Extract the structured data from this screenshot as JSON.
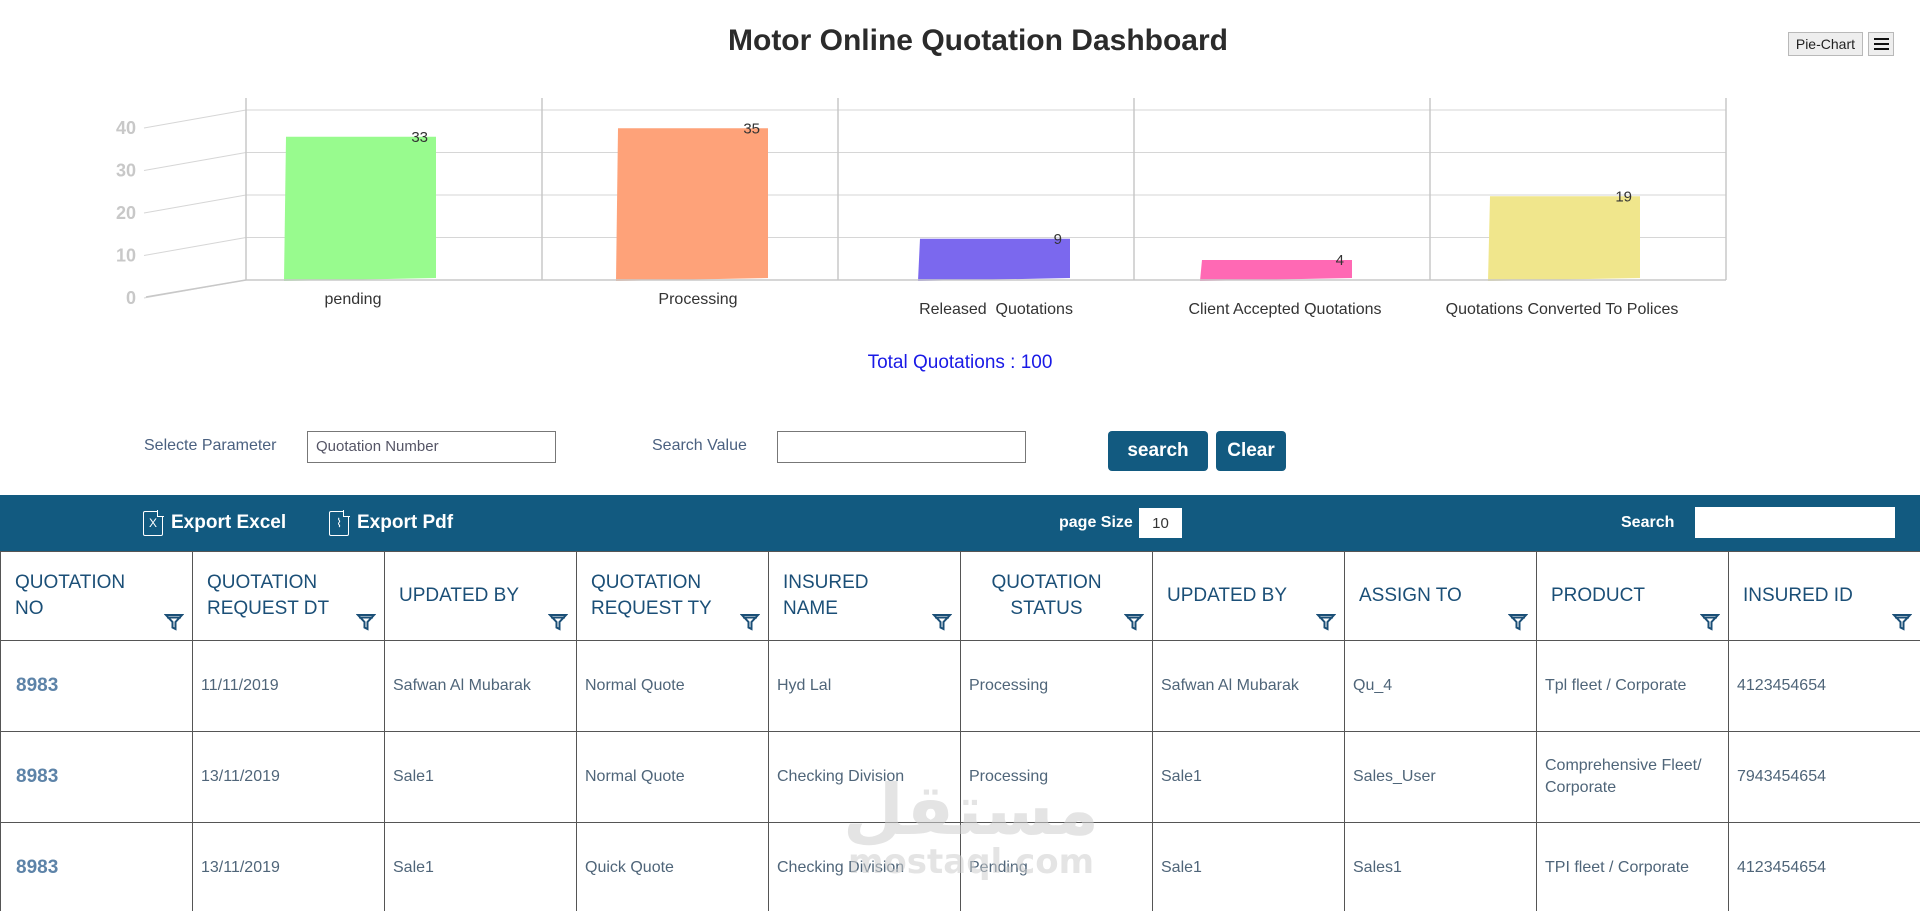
{
  "page_title": "Motor Online Quotation Dashboard",
  "chart_controls": {
    "pie_chart_label": "Pie-Chart",
    "menu_icon": "hamburger-menu-icon"
  },
  "chart_data": {
    "type": "bar",
    "style": "3d",
    "categories": [
      "pending",
      "Processing",
      "Released  Quotations",
      "Client Accepted Quotations",
      "Quotations Converted To Polices"
    ],
    "values": [
      33,
      35,
      9,
      4,
      19
    ],
    "colors": [
      "#98fb8e",
      "#fea279",
      "#7b68ee",
      "#ff69b4",
      "#f0e68c"
    ],
    "ylim": [
      0,
      40
    ],
    "yticks": [
      0,
      10,
      20,
      30,
      40
    ],
    "grid": true,
    "title": "",
    "xlabel": "",
    "ylabel": ""
  },
  "total_label": "Total Quotations : 100",
  "search_form": {
    "parameter_label": "Selecte Parameter",
    "parameter_value": "Quotation Number",
    "search_value_label": "Search Value",
    "search_value": "",
    "search_button": "search",
    "clear_button": "Clear"
  },
  "toolbar": {
    "export_excel": "Export Excel",
    "excel_icon_glyph": "X",
    "export_pdf": "Export Pdf",
    "pdf_icon_glyph": "⌇",
    "page_size_label": "page Size",
    "page_size_value": "10",
    "search_label": "Search",
    "background_color": "#125a80"
  },
  "table": {
    "headers": [
      "QUOTATION NO",
      "QUOTATION REQUEST DT",
      "UPDATED BY",
      "QUOTATION REQUEST TY",
      "INSURED NAME",
      "QUOTATION STATUS",
      "UPDATED BY",
      "ASSIGN TO",
      "PRODUCT",
      "INSURED ID"
    ],
    "rows": [
      [
        "8983",
        "11/11/2019",
        "Safwan Al Mubarak",
        "Normal Quote",
        "Hyd Lal",
        "Processing",
        "Safwan Al Mubarak",
        "Qu_4",
        "Tpl fleet / Corporate",
        "4123454654"
      ],
      [
        "8983",
        "13/11/2019",
        "Sale1",
        "Normal Quote",
        "Checking Division",
        "Processing",
        "Sale1",
        "Sales_User",
        "Comprehensive Fleet/ Corporate",
        "7943454654"
      ],
      [
        "8983",
        "13/11/2019",
        "Sale1",
        "Quick Quote",
        "Checking Division",
        "Pending",
        "Sale1",
        "Sales1",
        "TPI fleet / Corporate",
        "4123454654"
      ]
    ]
  },
  "watermark": {
    "arabic": "مستقل",
    "latin": "mostaql.com"
  }
}
